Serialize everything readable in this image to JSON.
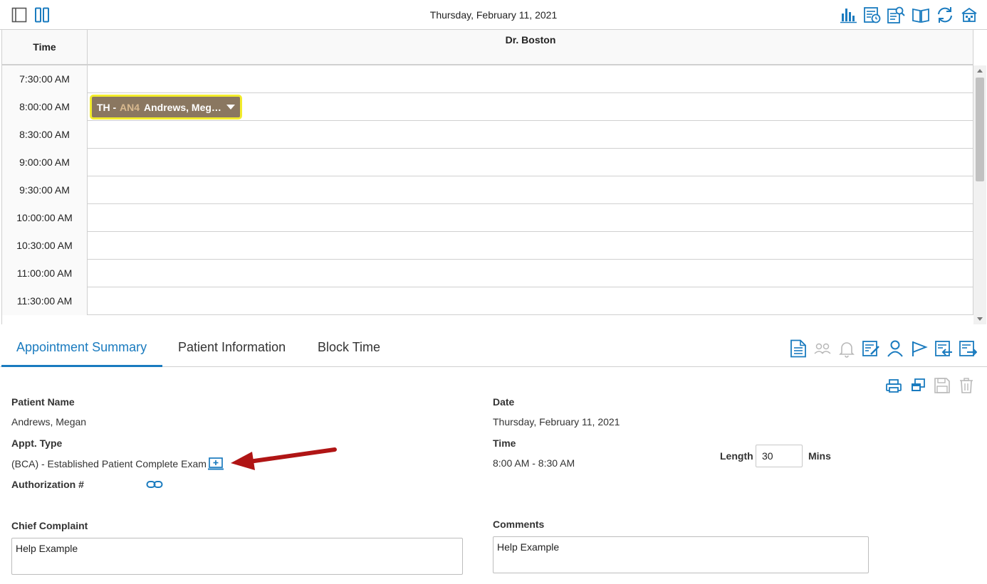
{
  "topbar": {
    "date": "Thursday, February 11, 2021",
    "icons": [
      "bar-chart-icon",
      "schedule-report-icon",
      "document-search-icon",
      "book-icon",
      "refresh-icon",
      "office-icon"
    ]
  },
  "grid": {
    "time_header": "Time",
    "provider_header": "Dr. Boston",
    "times": [
      "7:30:00 AM",
      "8:00:00 AM",
      "8:30:00 AM",
      "9:00:00 AM",
      "9:30:00 AM",
      "10:00:00 AM",
      "10:30:00 AM",
      "11:00:00 AM",
      "11:30:00 AM"
    ]
  },
  "appointment": {
    "code": "TH -",
    "code2": "AN4",
    "patient": "Andrews, Megan",
    "colors": {
      "background": "#8a7760",
      "border": "#f2ec2c",
      "code2": "#d8b98f"
    }
  },
  "tabs": [
    {
      "label": "Appointment Summary",
      "active": true
    },
    {
      "label": "Patient Information",
      "active": false
    },
    {
      "label": "Block Time",
      "active": false
    }
  ],
  "summary": {
    "patient_name_label": "Patient Name",
    "patient_name": "Andrews, Megan",
    "appt_type_label": "Appt. Type",
    "appt_type": "(BCA) - Established Patient Complete Exam",
    "authorization_label": "Authorization #",
    "date_label": "Date",
    "date": "Thursday, February 11, 2021",
    "time_label": "Time",
    "time": "8:00 AM - 8:30 AM",
    "length_label": "Length",
    "length_value": "30",
    "length_unit": "Mins",
    "chief_complaint_label": "Chief Complaint",
    "chief_complaint": "Help Example",
    "comments_label": "Comments",
    "comments": "Help Example"
  },
  "colors": {
    "accent": "#1a7bbf",
    "arrow": "#b01515",
    "disabled": "#b8b8b8"
  }
}
